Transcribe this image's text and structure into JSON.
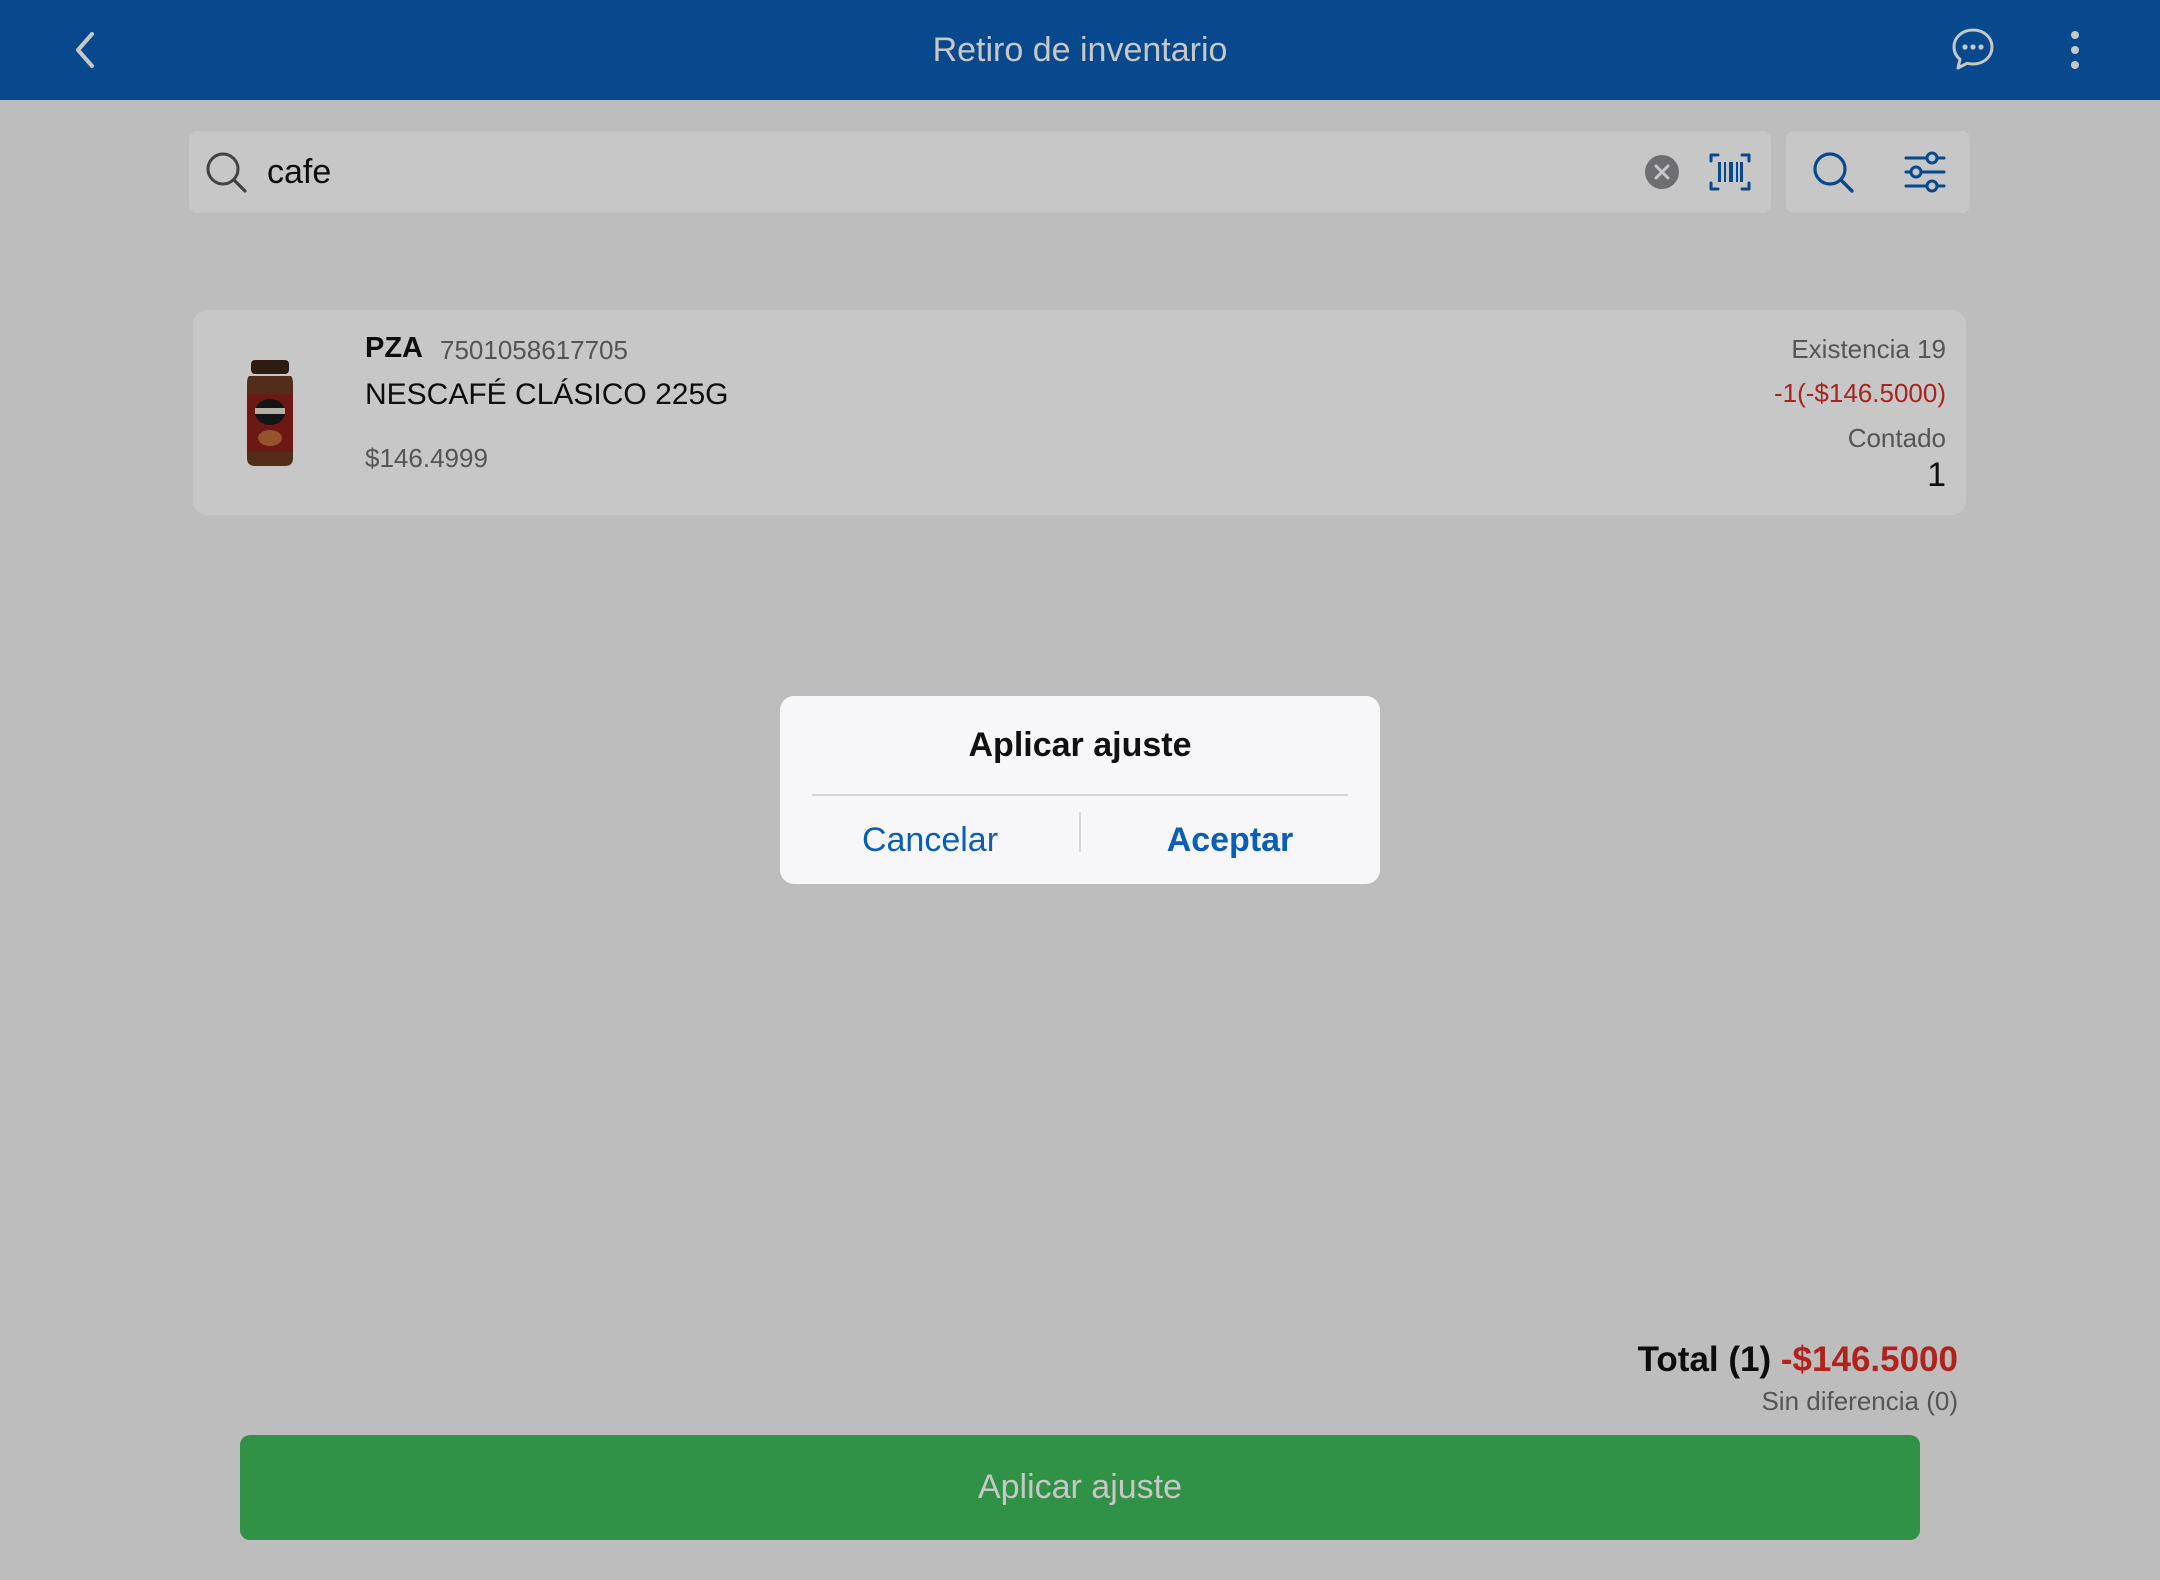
{
  "header": {
    "title": "Retiro de inventario",
    "back_icon": "chevron-left-icon",
    "chat_icon": "chat-bubble-icon",
    "more_icon": "more-vertical-icon",
    "background_color": "#0b5eb6"
  },
  "search": {
    "value": "cafe",
    "placeholder": "",
    "search_icon": "search-icon",
    "clear_icon": "clear-circle-icon",
    "barcode_icon": "barcode-scan-icon",
    "tool_search_icon": "search-icon",
    "tool_filter_icon": "filter-sliders-icon"
  },
  "products": [
    {
      "unit": "PZA",
      "barcode": "7501058617705",
      "name": "NESCAFÉ CLÁSICO 225G",
      "price": "$146.4999",
      "stock": "Existencia 19",
      "difference": "-1(-$146.5000)",
      "counted_label": "Contado",
      "counted_value": "1"
    }
  ],
  "totals": {
    "total_label": "Total (1)",
    "total_amount": "-$146.5000",
    "difference_note": "Sin diferencia (0)",
    "amount_color": "#e52c24"
  },
  "apply_button": {
    "label": "Aplicar ajuste",
    "color": "#3dbb5a"
  },
  "dialog": {
    "title": "Aplicar ajuste",
    "cancel_label": "Cancelar",
    "accept_label": "Aceptar"
  }
}
